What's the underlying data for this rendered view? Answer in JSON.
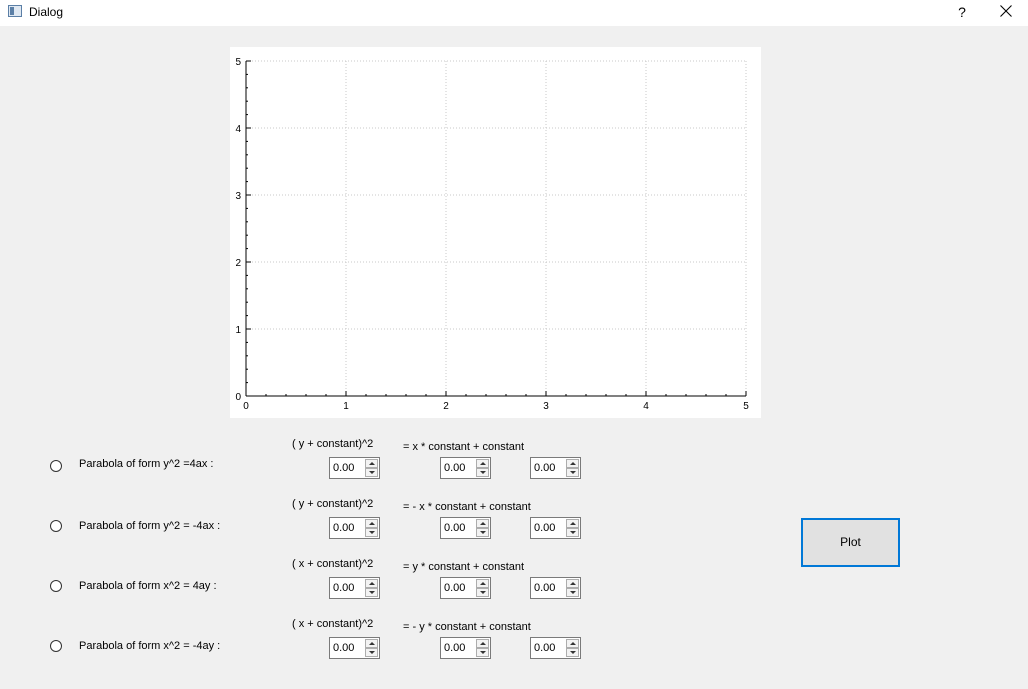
{
  "window": {
    "title": "Dialog",
    "help_label": "?"
  },
  "chart_data": {
    "type": "line",
    "title": "",
    "xlabel": "",
    "ylabel": "",
    "xlim": [
      0,
      5
    ],
    "ylim": [
      0,
      5
    ],
    "x_ticks": [
      "0",
      "1",
      "2",
      "3",
      "4",
      "5"
    ],
    "y_ticks": [
      "0",
      "1",
      "2",
      "3",
      "4",
      "5"
    ],
    "grid": true,
    "series": []
  },
  "rows": [
    {
      "option": "Parabola of form y^2 =4ax :",
      "lhs": "( y + constant)^2",
      "rhs": "= x * constant  +   constant",
      "values": [
        "0.00",
        "0.00",
        "0.00"
      ]
    },
    {
      "option": "Parabola of form y^2 =  -4ax :",
      "lhs": "( y + constant)^2",
      "rhs": "=  - x * constant   +   constant",
      "values": [
        "0.00",
        "0.00",
        "0.00"
      ]
    },
    {
      "option": "Parabola of form x^2 =  4ay :",
      "lhs": "( x + constant)^2",
      "rhs": "= y * constant   +   constant",
      "values": [
        "0.00",
        "0.00",
        "0.00"
      ]
    },
    {
      "option": "Parabola of form x^2 =  -4ay :",
      "lhs": "( x + constant)^2",
      "rhs": "= -  y * constant   +   constant",
      "values": [
        "0.00",
        "0.00",
        "0.00"
      ]
    }
  ],
  "plot_button": {
    "label": "Plot"
  }
}
